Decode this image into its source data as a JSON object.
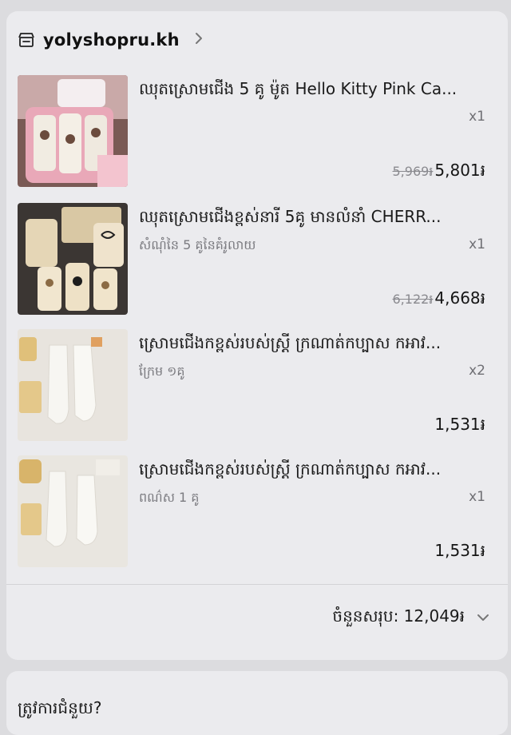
{
  "shop": {
    "name": "yolyshopru.kh"
  },
  "items": [
    {
      "title": "ឈុតស្រោមជើង 5 គូ ម៉ូត Hello Kitty Pink Ca...",
      "variant": "",
      "qty": "x1",
      "old_price": "5,969៛",
      "price": "5,801៛"
    },
    {
      "title": "ឈុតស្រោមជើងខ្ពស់នារី 5គូ មានលំនាំ CHERR...",
      "variant": "សំណុំនៃ 5 គូនៃគំរូលាយ",
      "qty": "x1",
      "old_price": "6,122៛",
      "price": "4,668៛"
    },
    {
      "title": "ស្រោមជើងកខ្ពស់របស់ស្ត្រី ក្រណាត់កប្បាស កអាវ...",
      "variant": "ក្រែម ១គូ",
      "qty": "x2",
      "old_price": "",
      "price": "1,531៛"
    },
    {
      "title": "ស្រោមជើងកខ្ពស់របស់ស្ត្រី ក្រណាត់កប្បាស កអាវ...",
      "variant": "ពណ៌ស 1 គូ",
      "qty": "x1",
      "old_price": "",
      "price": "1,531៛"
    }
  ],
  "summary": {
    "total_label": "ចំនួនសរុប: 12,049៛"
  },
  "help": {
    "label": "ត្រូវការជំនួយ?"
  },
  "icons": {
    "store": "store-icon",
    "chevron_right": "chevron-right-icon",
    "chevron_down": "chevron-down-icon"
  },
  "colors": {
    "background": "#dcdcdf",
    "card": "#ebebee",
    "muted_text": "#7b7b80"
  }
}
